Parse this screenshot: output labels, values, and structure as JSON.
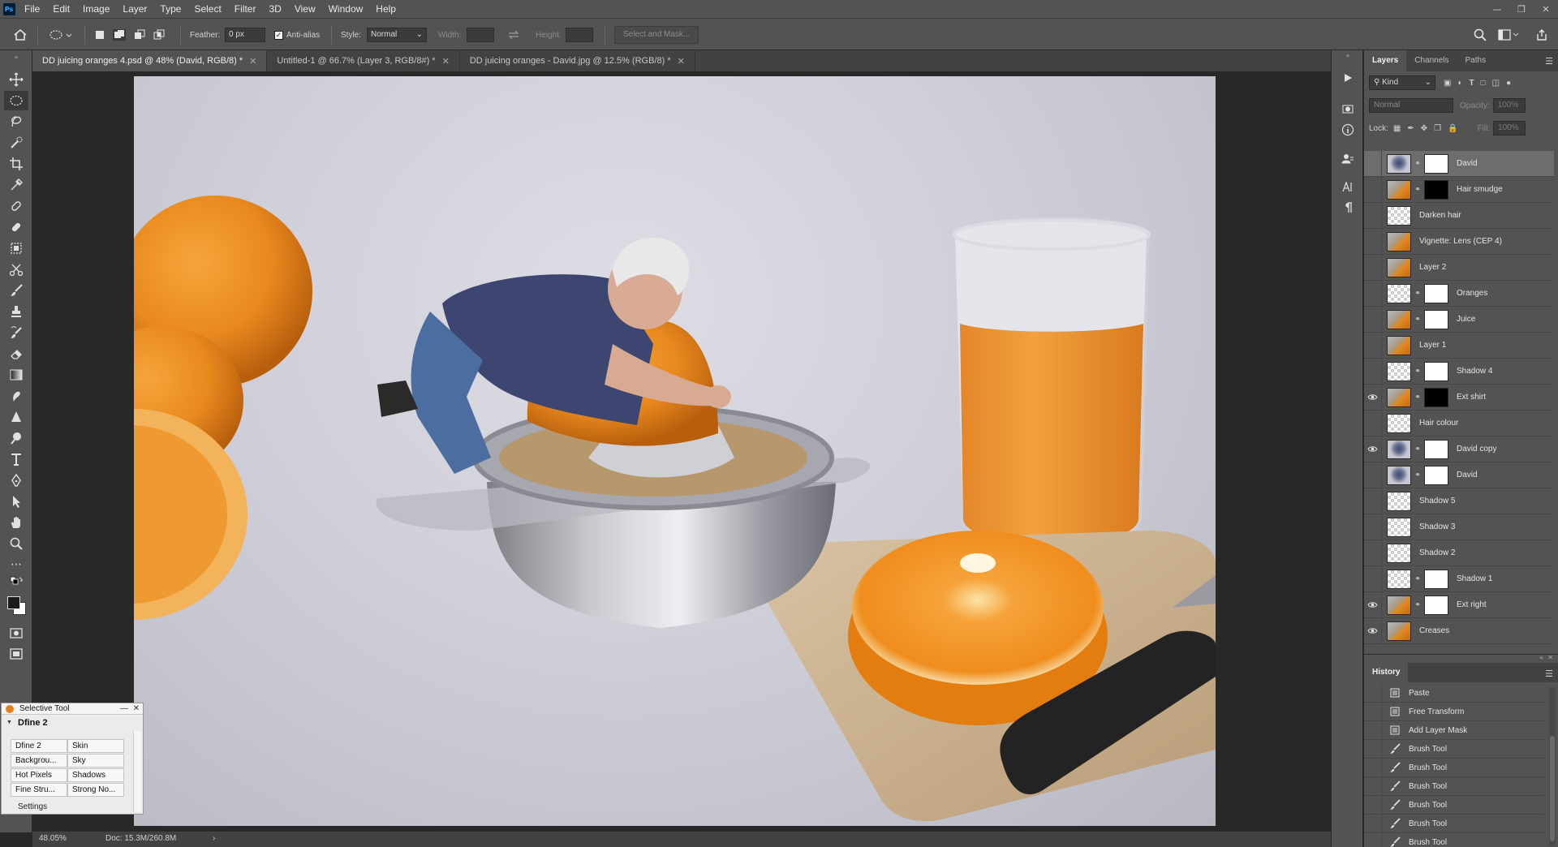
{
  "menu": [
    "File",
    "Edit",
    "Image",
    "Layer",
    "Type",
    "Select",
    "Filter",
    "3D",
    "View",
    "Window",
    "Help"
  ],
  "app_logo": "Ps",
  "options": {
    "feather_label": "Feather:",
    "feather_value": "0 px",
    "antialias_label": "Anti-alias",
    "style_label": "Style:",
    "style_value": "Normal",
    "width_label": "Width:",
    "height_label": "Height:",
    "select_mask_label": "Select and Mask..."
  },
  "tabs": [
    {
      "label": "DD juicing oranges 4.psd @ 48% (David, RGB/8) *",
      "active": true
    },
    {
      "label": "Untitled-1 @ 66.7% (Layer 3, RGB/8#) *",
      "active": false
    },
    {
      "label": "DD juicing oranges - David.jpg @ 12.5% (RGB/8) *",
      "active": false
    }
  ],
  "layers_panel": {
    "tabs": [
      "Layers",
      "Channels",
      "Paths"
    ],
    "filter_value": "Kind",
    "blend_mode": "Normal",
    "opacity_label": "Opacity:",
    "opacity_value": "100%",
    "lock_label": "Lock:",
    "fill_label": "Fill:",
    "fill_value": "100%",
    "layers": [
      {
        "name": "David",
        "visible": false,
        "selected": true,
        "thumb": "img2",
        "mask": "white"
      },
      {
        "name": "Hair smudge",
        "visible": false,
        "selected": false,
        "thumb": "img",
        "mask": "black"
      },
      {
        "name": "Darken hair",
        "visible": false,
        "selected": false,
        "thumb": "trans",
        "mask": ""
      },
      {
        "name": "Vignette: Lens (CEP 4)",
        "visible": false,
        "selected": false,
        "thumb": "img",
        "mask": ""
      },
      {
        "name": "Layer 2",
        "visible": false,
        "selected": false,
        "thumb": "img",
        "mask": ""
      },
      {
        "name": "Oranges",
        "visible": false,
        "selected": false,
        "thumb": "trans",
        "mask": "white"
      },
      {
        "name": "Juice",
        "visible": false,
        "selected": false,
        "thumb": "img",
        "mask": "white"
      },
      {
        "name": "Layer 1",
        "visible": false,
        "selected": false,
        "thumb": "img",
        "mask": ""
      },
      {
        "name": "Shadow 4",
        "visible": false,
        "selected": false,
        "thumb": "trans",
        "mask": "white"
      },
      {
        "name": "Ext shirt",
        "visible": true,
        "selected": false,
        "thumb": "img",
        "mask": "black"
      },
      {
        "name": "Hair colour",
        "visible": false,
        "selected": false,
        "thumb": "trans",
        "mask": ""
      },
      {
        "name": "David copy",
        "visible": true,
        "selected": false,
        "thumb": "img2",
        "mask": "white"
      },
      {
        "name": "David",
        "visible": false,
        "selected": false,
        "thumb": "img2",
        "mask": "white"
      },
      {
        "name": "Shadow 5",
        "visible": false,
        "selected": false,
        "thumb": "trans",
        "mask": ""
      },
      {
        "name": "Shadow 3",
        "visible": false,
        "selected": false,
        "thumb": "trans",
        "mask": ""
      },
      {
        "name": "Shadow 2",
        "visible": false,
        "selected": false,
        "thumb": "trans",
        "mask": ""
      },
      {
        "name": "Shadow 1",
        "visible": false,
        "selected": false,
        "thumb": "trans",
        "mask": "white"
      },
      {
        "name": "Ext right",
        "visible": true,
        "selected": false,
        "thumb": "img",
        "mask": "white"
      },
      {
        "name": "Creases",
        "visible": true,
        "selected": false,
        "thumb": "img",
        "mask": ""
      }
    ]
  },
  "history_panel": {
    "title": "History",
    "items": [
      {
        "name": "Paste",
        "icon": "document-icon"
      },
      {
        "name": "Free Transform",
        "icon": "document-icon"
      },
      {
        "name": "Add Layer Mask",
        "icon": "document-icon"
      },
      {
        "name": "Brush Tool",
        "icon": "brush-icon"
      },
      {
        "name": "Brush Tool",
        "icon": "brush-icon"
      },
      {
        "name": "Brush Tool",
        "icon": "brush-icon"
      },
      {
        "name": "Brush Tool",
        "icon": "brush-icon"
      },
      {
        "name": "Brush Tool",
        "icon": "brush-icon"
      },
      {
        "name": "Brush Tool",
        "icon": "brush-icon"
      }
    ]
  },
  "selective_tool": {
    "title": "Selective Tool",
    "plugin": "Dfine 2",
    "buttons": [
      "Dfine 2",
      "Skin",
      "Backgrou...",
      "Sky",
      "Hot Pixels",
      "Shadows",
      "Fine Stru...",
      "Strong No..."
    ],
    "settings_label": "Settings"
  },
  "status": {
    "zoom": "48.05%",
    "doc": "Doc: 15.3M/260.8M",
    "arrow": "›"
  },
  "colors": {
    "ui_panel": "#535353",
    "ui_dark": "#282828",
    "orange": "#e8891e",
    "shirt": "#3d4670"
  }
}
